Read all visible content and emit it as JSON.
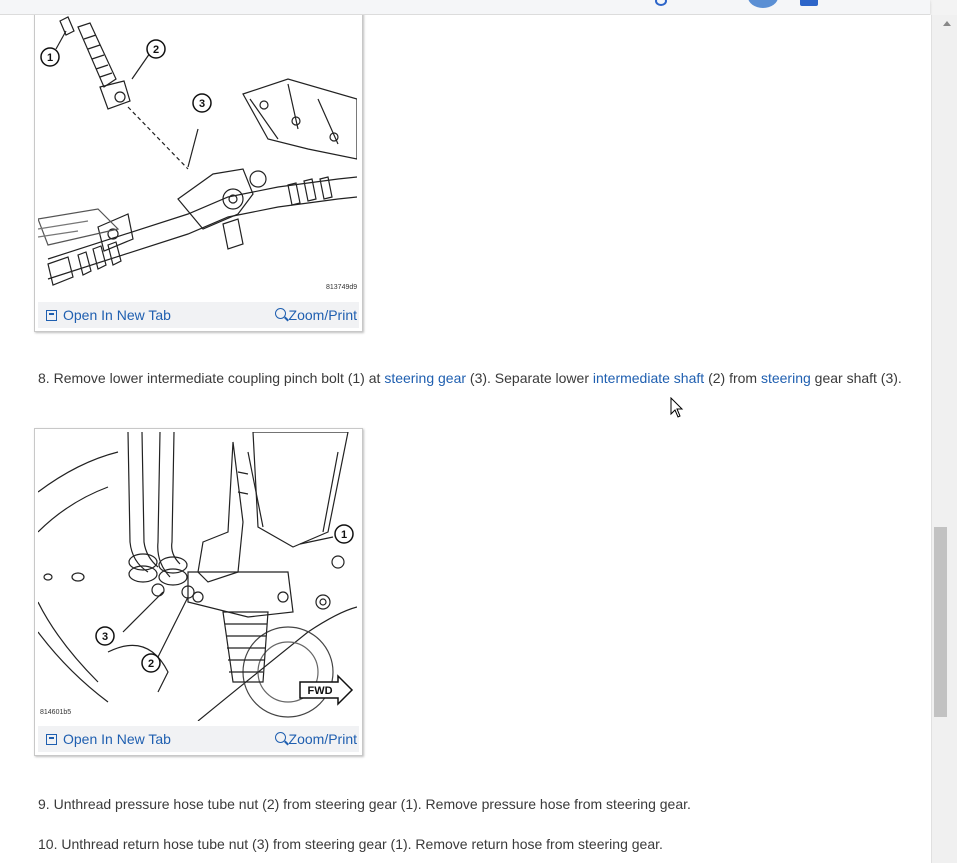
{
  "figures": [
    {
      "id": "813749d9",
      "image_code": "813749d9",
      "callouts": [
        "1",
        "2",
        "3"
      ],
      "open_label": "Open In New Tab",
      "zoom_label": "Zoom/Print"
    },
    {
      "id": "814601b5",
      "image_code": "814601b5",
      "callouts": [
        "1",
        "2",
        "3"
      ],
      "direction_label": "FWD",
      "open_label": "Open In New Tab",
      "zoom_label": "Zoom/Print"
    }
  ],
  "steps": {
    "step8": {
      "num": "8.",
      "t1": "Remove lower intermediate coupling pinch bolt (1) at",
      "link1": "steering gear",
      "t2": "(3). Separate lower",
      "link2": "intermediate shaft",
      "t3": "(2) from",
      "link3": "steering",
      "t4": "gear shaft (3)."
    },
    "step9": {
      "num": "9.",
      "text": "Unthread pressure hose tube nut (2) from steering gear (1). Remove pressure hose from steering gear."
    },
    "step10": {
      "num": "10.",
      "text": "Unthread return hose tube nut (3) from steering gear (1). Remove return hose from steering gear."
    }
  },
  "colors": {
    "link": "#1f5fb0",
    "text": "#3a3a3a",
    "accent": "#2d65c9"
  },
  "icons": [
    "open-in-new-tab-icon",
    "zoom-icon",
    "cursor-icon",
    "avatar",
    "scroll-up-icon"
  ]
}
